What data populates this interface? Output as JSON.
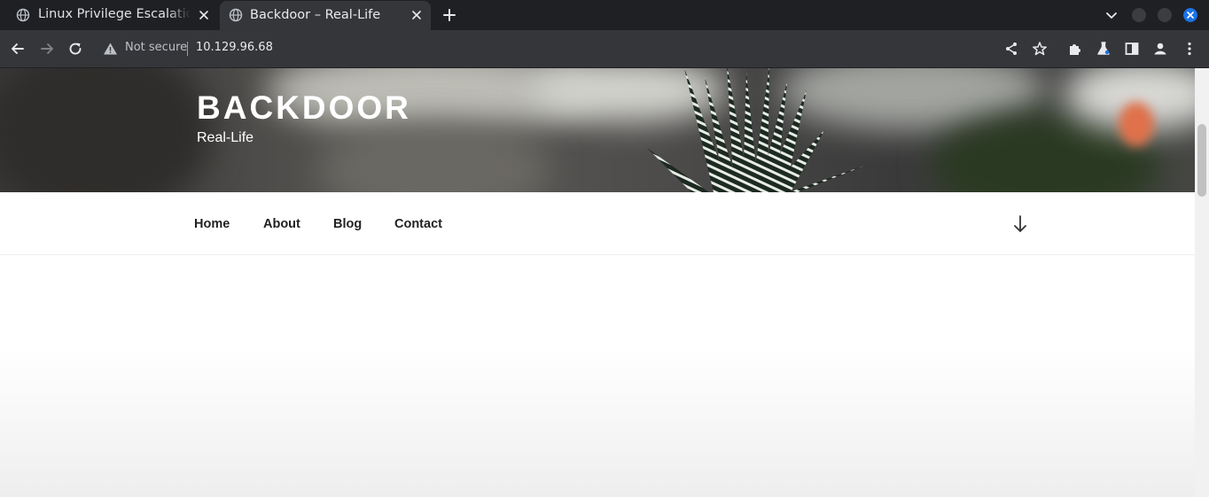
{
  "browser": {
    "tabs": [
      {
        "title": "Linux Privilege Escalation",
        "favicon": "globe-icon",
        "active": false
      },
      {
        "title": "Backdoor – Real-Life",
        "favicon": "globe-icon",
        "active": true
      }
    ],
    "address_bar": {
      "security_label": "Not secure",
      "url": "10.129.96.68"
    },
    "colors": {
      "tabstrip": "#1f2024",
      "toolbar": "#35363a",
      "close_button": "#1a73e8"
    }
  },
  "page": {
    "site_title": "BACKDOOR",
    "site_tagline": "Real-Life",
    "nav": [
      {
        "label": "Home"
      },
      {
        "label": "About"
      },
      {
        "label": "Blog"
      },
      {
        "label": "Contact"
      }
    ]
  }
}
